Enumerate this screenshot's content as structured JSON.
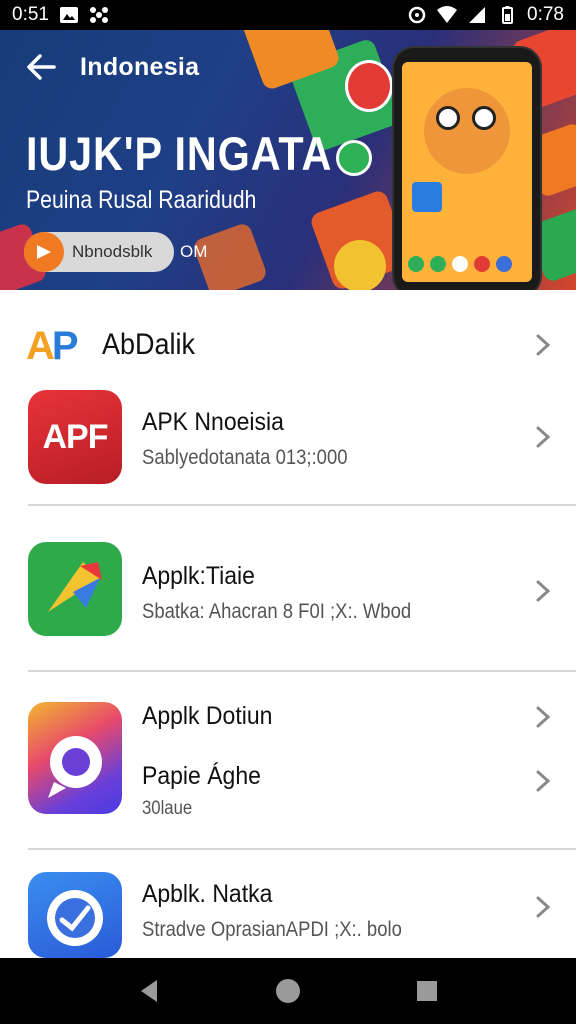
{
  "status_bar": {
    "time_left": "0:51",
    "time_right": "0:78"
  },
  "hero": {
    "title": "Indonesia",
    "headline": "IUJK'P INGATA",
    "subtitle": "Peuina Rusal Raaridudh",
    "pill_label": "Nbnodsblk",
    "pill_extra": "OM"
  },
  "section": {
    "logo_a": "A",
    "logo_p": "P",
    "title": "AbDalik"
  },
  "apps": [
    {
      "icon_text": "APF",
      "name": "APK Nnoeisia",
      "sub": "Sablyedotanata 013;:000"
    },
    {
      "icon_text": "",
      "name": "Applk:Tiaie",
      "sub": "Sbatka: Ahacran 8 F0I ;X:. Wbod"
    },
    {
      "icon_text": "",
      "name": "Applk Dotiun",
      "sub2_name": "Papie Ághe",
      "sub": "30laue"
    },
    {
      "icon_text": "",
      "name": "Apblk. Natka",
      "sub": "Stradve OprasianAPDI ;X:. bolo"
    }
  ],
  "colors": {
    "apf_red": "#d4262c",
    "green_icon": "#2faa4a",
    "purple_icon": "#6a3fd8",
    "blue_icon": "#2f6fe0"
  }
}
